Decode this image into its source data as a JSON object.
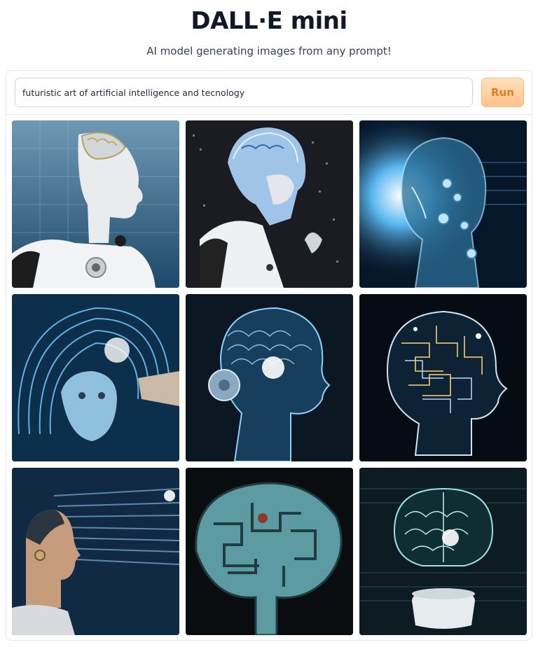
{
  "app": {
    "title": "DALL·E mini",
    "subtitle": "AI model generating images from any prompt!"
  },
  "prompt": {
    "value": "futuristic art of artificial intelligence and tecnology"
  },
  "run_button": {
    "label": "Run"
  },
  "accent_colors": {
    "run_bg": "#fdc48c",
    "run_text": "#ea7a19"
  },
  "gallery": {
    "images": [
      {
        "subject": "white robot with exposed brain, profile"
      },
      {
        "subject": "robot with glowing blue brain, dark background"
      },
      {
        "subject": "transparent glass humanoid head with blue light"
      },
      {
        "subject": "blue humanoid face with swirling light waves"
      },
      {
        "subject": "glowing wireframe head profile with brain"
      },
      {
        "subject": "circuit maze head profile"
      },
      {
        "subject": "human profile dissolving into digital streams"
      },
      {
        "subject": "teal maze brain sculpture"
      },
      {
        "subject": "glowing brain above white pedestal"
      }
    ]
  }
}
